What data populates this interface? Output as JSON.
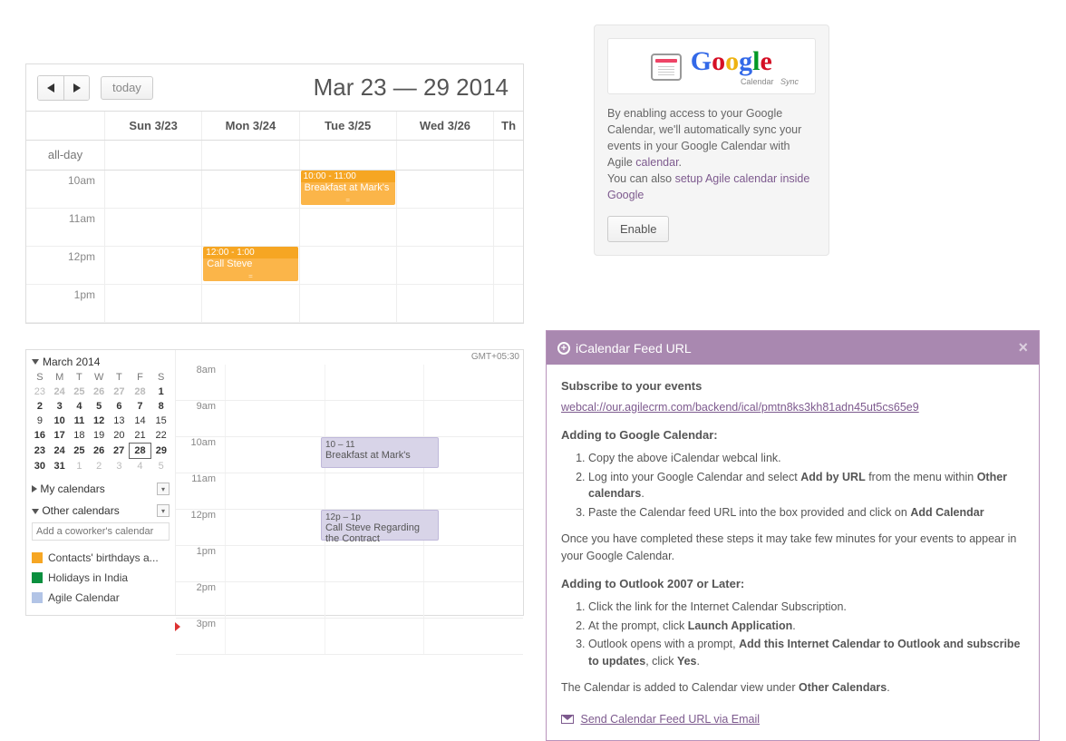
{
  "weekcal": {
    "title": "Mar 23 — 29 2014",
    "today_label": "today",
    "allday_label": "all-day",
    "days": [
      "Sun 3/23",
      "Mon 3/24",
      "Tue 3/25",
      "Wed 3/26",
      "Th"
    ],
    "hours": [
      "10am",
      "11am",
      "12pm",
      "1pm"
    ],
    "events": [
      {
        "day": 2,
        "hour_idx": 0,
        "span": 1,
        "time": "10:00 - 11:00",
        "title": "Breakfast at Mark's"
      },
      {
        "day": 1,
        "hour_idx": 2,
        "span": 1,
        "time": "12:00 - 1:00",
        "title": "Call Steve"
      }
    ]
  },
  "gcal": {
    "month": "March 2014",
    "dow": [
      "S",
      "M",
      "T",
      "W",
      "T",
      "F",
      "S"
    ],
    "weeks": [
      [
        {
          "n": 23,
          "dim": true
        },
        {
          "n": 24,
          "dim": true,
          "b": true
        },
        {
          "n": 25,
          "dim": true,
          "b": true
        },
        {
          "n": 26,
          "dim": true,
          "b": true
        },
        {
          "n": 27,
          "dim": true,
          "b": true
        },
        {
          "n": 28,
          "dim": true,
          "b": true
        },
        {
          "n": 1,
          "b": true
        }
      ],
      [
        {
          "n": 2,
          "b": true
        },
        {
          "n": 3,
          "b": true
        },
        {
          "n": 4,
          "b": true
        },
        {
          "n": 5,
          "b": true
        },
        {
          "n": 6,
          "b": true
        },
        {
          "n": 7,
          "b": true
        },
        {
          "n": 8,
          "b": true
        }
      ],
      [
        {
          "n": 9
        },
        {
          "n": 10,
          "b": true
        },
        {
          "n": 11,
          "b": true
        },
        {
          "n": 12,
          "b": true
        },
        {
          "n": 13
        },
        {
          "n": 14
        },
        {
          "n": 15
        }
      ],
      [
        {
          "n": 16,
          "b": true
        },
        {
          "n": 17,
          "b": true
        },
        {
          "n": 18
        },
        {
          "n": 19
        },
        {
          "n": 20
        },
        {
          "n": 21
        },
        {
          "n": 22
        }
      ],
      [
        {
          "n": 23,
          "b": true
        },
        {
          "n": 24,
          "b": true
        },
        {
          "n": 25,
          "b": true
        },
        {
          "n": 26,
          "b": true
        },
        {
          "n": 27,
          "b": true
        },
        {
          "n": 28,
          "b": true,
          "today": true
        },
        {
          "n": 29,
          "b": true
        }
      ],
      [
        {
          "n": 30,
          "b": true
        },
        {
          "n": 31,
          "b": true
        },
        {
          "n": 1,
          "dim": true
        },
        {
          "n": 2,
          "dim": true
        },
        {
          "n": 3,
          "dim": true
        },
        {
          "n": 4,
          "dim": true
        },
        {
          "n": 5,
          "dim": true
        }
      ]
    ],
    "my_calendars": "My calendars",
    "other_calendars": "Other calendars",
    "add_coworker_placeholder": "Add a coworker's calendar",
    "calendars": [
      {
        "color": "#f6a623",
        "name": "Contacts' birthdays a..."
      },
      {
        "color": "#0a8f3e",
        "name": "Holidays in India"
      },
      {
        "color": "#b2c4e6",
        "name": "Agile Calendar"
      }
    ],
    "tz": "GMT+05:30",
    "hours": [
      "8am",
      "9am",
      "10am",
      "11am",
      "12pm",
      "1pm",
      "2pm",
      "3pm"
    ],
    "events": [
      {
        "hour_idx": 2,
        "time": "10 – 11",
        "title": "Breakfast at Mark's"
      },
      {
        "hour_idx": 4,
        "time": "12p – 1p",
        "title": "Call Steve Regarding the Contract"
      }
    ]
  },
  "sync": {
    "logo_word": "Google",
    "logo_sub1": "Calendar",
    "logo_sub2": "Sync",
    "text1": "By enabling access to your Google Calendar, we'll automatically sync your events in your Google Calendar with Agile ",
    "link1": "calendar",
    "text2": "You can also ",
    "link2": "setup Agile calendar inside Google",
    "enable": "Enable"
  },
  "ical": {
    "title": "iCalendar Feed URL",
    "subscribe_heading": "Subscribe to your events",
    "url": "webcal://our.agilecrm.com/backend/ical/pmtn8ks3kh81adn45ut5cs65e9",
    "gcal_heading": "Adding to Google Calendar:",
    "gcal_steps": [
      "Copy the above iCalendar webcal link.",
      "Log into your Google Calendar and select <b>Add by URL</b> from the menu within <b>Other calendars</b>.",
      "Paste the Calendar feed URL into the box provided and click on <b>Add Calendar</b>"
    ],
    "gcal_note": "Once you have completed these steps it may take few minutes for your events to appear in your Google Calendar.",
    "outlook_heading": "Adding to Outlook 2007 or Later:",
    "outlook_steps": [
      "Click the link for the Internet Calendar Subscription.",
      "At the prompt, click <b>Launch Application</b>.",
      "Outlook opens with a prompt, <b>Add this Internet Calendar to Outlook and subscribe to updates</b>, click <b>Yes</b>."
    ],
    "outlook_note": "The Calendar is added to Calendar view under <b>Other Calendars</b>.",
    "send_link": "Send Calendar Feed URL via Email"
  }
}
